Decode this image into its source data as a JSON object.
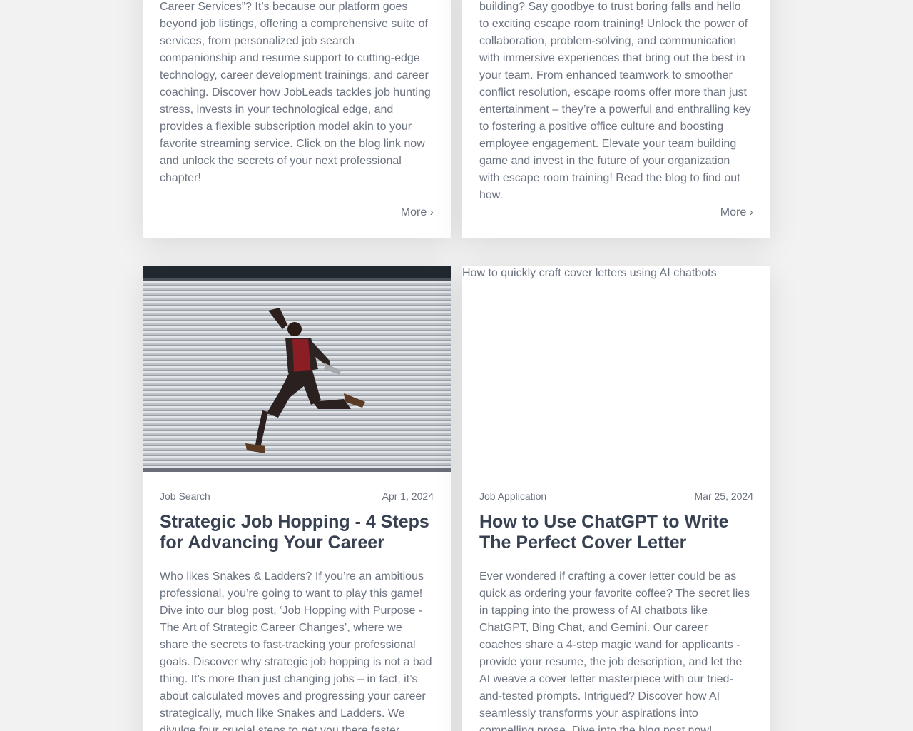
{
  "cards": [
    {
      "excerpt": "Career Services”? It’s because our platform goes beyond job listings, offering a comprehensive suite of services, from personalized job search companionship and resume support to cutting-edge technology, career development trainings, and career coaching. Discover how JobLeads tackles job hunting stress, invests in your technological edge, and provides a flexible subscription model akin to your favorite streaming service. Click on the blog link now and unlock the secrets of your next professional chapter!",
      "more_label": "More ›"
    },
    {
      "excerpt": "building? Say goodbye to trust boring falls and hello to exciting escape room training! Unlock the power of collaboration, problem-solving, and communication with immersive experiences that bring out the best in your team. From enhanced teamwork to smoother conflict resolution, escape rooms offer more than just entertainment – they’re a powerful and enthralling key to fostering a positive office culture and boosting employee engagement. Elevate your team building game and invest in the future of your organization with escape room training! Read the blog to find out how.",
      "more_label": "More ›"
    },
    {
      "image_description": "man jumping in front of a metal shutter",
      "category": "Job Search",
      "date": "Apr 1, 2024",
      "title": "Strategic Job Hopping - 4 Steps for Advancing Your Career",
      "excerpt": "Who likes Snakes & Ladders? If you’re an ambitious professional, you’re going to want to play this game! Dive into our blog post, ‘Job Hopping with Purpose - The Art of Strategic Career Changes’, where we share the secrets to fast-tracking your professional goals. Discover why strategic job hopping is not a bad thing. It’s more than just changing jobs – in fact, it’s about calculated moves and progressing your career strategically, much like Snakes and Ladders. We divulge four crucial steps to get you there faster."
    },
    {
      "image_alt": "How to quickly craft cover letters using AI chatbots",
      "category": "Job Application",
      "date": "Mar 25, 2024",
      "title": "How to Use ChatGPT to Write The Perfect Cover Letter",
      "excerpt": "Ever wondered if crafting a cover letter could be as quick as ordering your favorite coffee? The secret lies in tapping into the prowess of AI chatbots like ChatGPT, Bing Chat, and Gemini. Our career coaches share a 4-step magic wand for applicants - provide your resume, the job description, and let the AI weave a cover letter masterpiece with our tried-and-tested prompts. Intrigued? Discover how AI seamlessly transforms your aspirations into compelling prose. Dive into the blog post now!"
    }
  ],
  "colors": {
    "background": "#f2f2f2",
    "card": "#ffffff",
    "text": "#6b7280",
    "title": "#374151"
  }
}
